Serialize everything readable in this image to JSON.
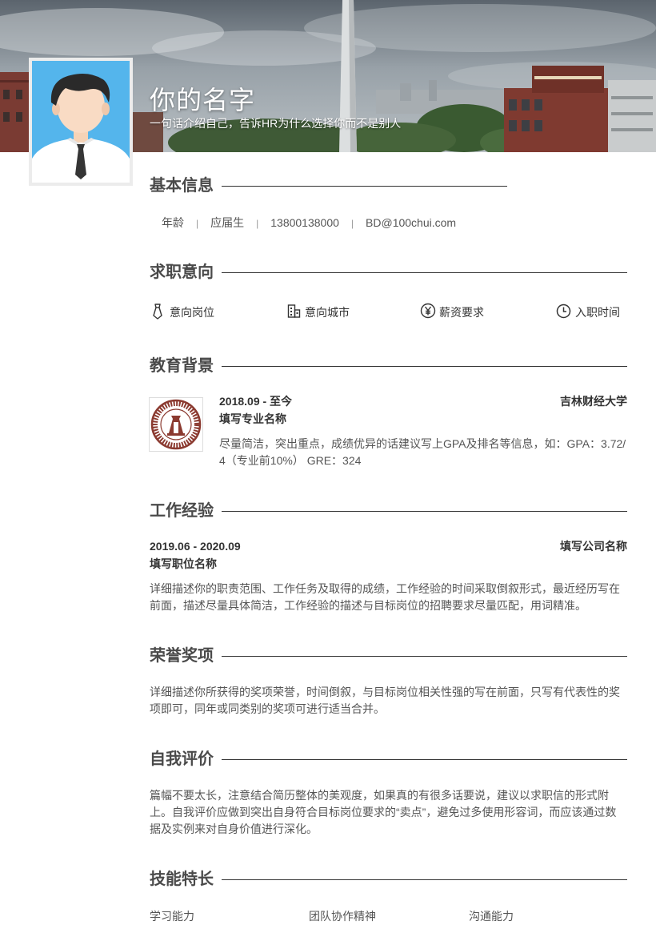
{
  "header": {
    "name": "你的名字",
    "tagline": "一句话介绍自己，告诉HR为什么选择你而不是别人"
  },
  "basic_info": {
    "title": "基本信息",
    "age": "年龄",
    "status": "应届生",
    "phone": "13800138000",
    "email": "BD@100chui.com"
  },
  "job_intent": {
    "title": "求职意向",
    "items": [
      {
        "label": "意向岗位",
        "icon": "tie-icon"
      },
      {
        "label": "意向城市",
        "icon": "building-icon"
      },
      {
        "label": "薪资要求",
        "icon": "yen-icon"
      },
      {
        "label": "入职时间",
        "icon": "clock-icon"
      }
    ]
  },
  "education": {
    "title": "教育背景",
    "period": "2018.09 - 至今",
    "school": "吉林财经大学",
    "major": "填写专业名称",
    "description": "尽量简洁，突出重点，成绩优异的话建议写上GPA及排名等信息，如：GPA：3.72/4（专业前10%） GRE：324"
  },
  "work": {
    "title": "工作经验",
    "period": "2019.06 - 2020.09",
    "company": "填写公司名称",
    "position": "填写职位名称",
    "description": "详细描述你的职责范围、工作任务及取得的成绩，工作经验的时间采取倒叙形式，最近经历写在前面，描述尽量具体简洁，工作经验的描述与目标岗位的招聘要求尽量匹配，用词精准。"
  },
  "honors": {
    "title": "荣誉奖项",
    "description": "详细描述你所获得的奖项荣誉，时间倒叙，与目标岗位相关性强的写在前面，只写有代表性的奖项即可，同年或同类别的奖项可进行适当合并。"
  },
  "self_eval": {
    "title": "自我评价",
    "description": "篇幅不要太长，注意结合简历整体的美观度，如果真的有很多话要说，建议以求职信的形式附上。自我评价应做到突出自身符合目标岗位要求的“卖点”，避免过多使用形容词，而应该通过数据及实例来对自身价值进行深化。"
  },
  "skills": {
    "title": "技能特长",
    "items": [
      "学习能力",
      "团队协作精神",
      "沟通能力"
    ]
  },
  "colors": {
    "accent": "#333333",
    "text": "#555555",
    "avatar_bg": "#54b5ec",
    "logo": "#8b3a30"
  }
}
